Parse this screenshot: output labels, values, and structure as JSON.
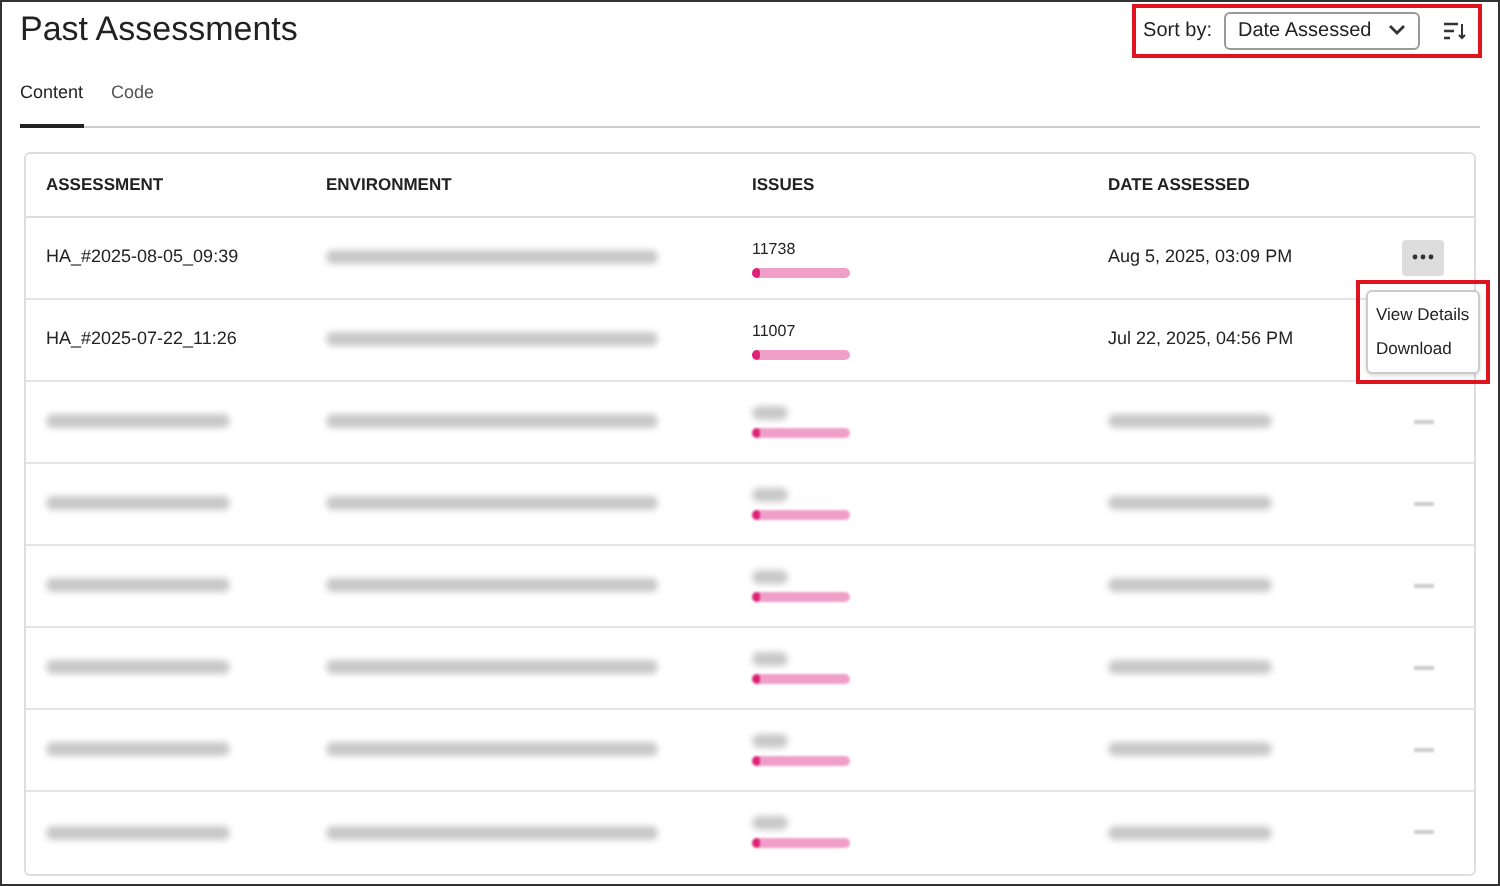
{
  "title": "Past Assessments",
  "sort": {
    "label": "Sort by:",
    "value": "Date Assessed"
  },
  "tabs": [
    {
      "label": "Content",
      "selected": true
    },
    {
      "label": "Code",
      "selected": false
    }
  ],
  "table": {
    "columns": [
      "ASSESSMENT",
      "ENVIRONMENT",
      "ISSUES",
      "DATE ASSESSED"
    ],
    "rows": [
      {
        "kind": "clear",
        "assessment": "HA_#2025-08-05_09:39",
        "issues": "11738",
        "level": 0.08,
        "date": "Aug 5, 2025, 03:09 PM"
      },
      {
        "kind": "clear",
        "assessment": "HA_#2025-07-22_11:26",
        "issues": "11007",
        "level": 0.08,
        "date": "Jul 22, 2025, 04:56 PM"
      },
      {
        "kind": "blurred",
        "level": 0.08
      },
      {
        "kind": "blurred",
        "level": 0.08
      },
      {
        "kind": "blurred",
        "level": 0.08
      },
      {
        "kind": "blurred",
        "level": 0.08
      },
      {
        "kind": "blurred",
        "level": 0.08
      },
      {
        "kind": "blurred",
        "level": 0.08
      }
    ]
  },
  "menu": {
    "open": true,
    "items": [
      "View Details",
      "Download"
    ]
  }
}
